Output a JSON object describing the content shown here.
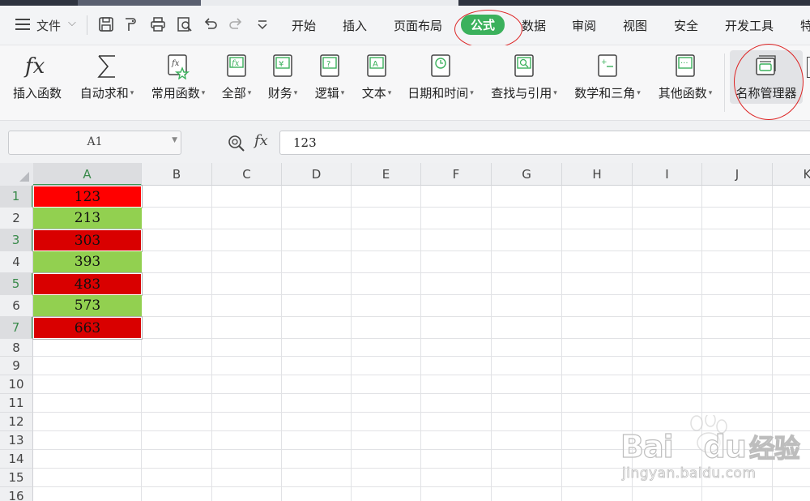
{
  "menu": {
    "file_label": "文件",
    "tabs": [
      "开始",
      "插入",
      "页面布局",
      "公式",
      "数据",
      "审阅",
      "视图",
      "安全",
      "开发工具",
      "特"
    ],
    "active_tab": "公式"
  },
  "ribbon": {
    "buttons": [
      {
        "label": "插入函数",
        "dropdown": false,
        "icon": "fx-icon"
      },
      {
        "label": "自动求和",
        "dropdown": true,
        "icon": "sigma-icon"
      },
      {
        "label": "常用函数",
        "dropdown": true,
        "icon": "common-functions-icon"
      },
      {
        "label": "全部",
        "dropdown": true,
        "icon": "all-functions-icon"
      },
      {
        "label": "财务",
        "dropdown": true,
        "icon": "finance-icon"
      },
      {
        "label": "逻辑",
        "dropdown": true,
        "icon": "logic-icon"
      },
      {
        "label": "文本",
        "dropdown": true,
        "icon": "text-icon"
      },
      {
        "label": "日期和时间",
        "dropdown": true,
        "icon": "datetime-icon"
      },
      {
        "label": "查找与引用",
        "dropdown": true,
        "icon": "lookup-icon"
      },
      {
        "label": "数学和三角",
        "dropdown": true,
        "icon": "math-icon"
      },
      {
        "label": "其他函数",
        "dropdown": true,
        "icon": "other-functions-icon"
      },
      {
        "label": "名称管理器",
        "dropdown": false,
        "icon": "name-manager-icon"
      }
    ]
  },
  "formula_bar": {
    "cell_ref": "A1",
    "fx_label": "fx",
    "value": "123"
  },
  "sheet": {
    "columns": [
      "A",
      "B",
      "C",
      "D",
      "E",
      "F",
      "G",
      "H",
      "I",
      "J",
      "K"
    ],
    "rows": [
      "1",
      "2",
      "3",
      "4",
      "5",
      "6",
      "7",
      "8",
      "9",
      "10",
      "11",
      "12",
      "13",
      "14",
      "15",
      "16"
    ],
    "selected_column": "A",
    "cells_a": [
      "123",
      "213",
      "303",
      "393",
      "483",
      "573",
      "663"
    ],
    "cell_colors": [
      "#ff0000",
      "#92d050",
      "#d90000",
      "#92d050",
      "#d90000",
      "#92d050",
      "#d90000"
    ]
  },
  "watermark": {
    "brand_letters": "Bai",
    "brand_tail": "du",
    "brand_cn": "经验",
    "url": "jingyan.baidu.com"
  }
}
